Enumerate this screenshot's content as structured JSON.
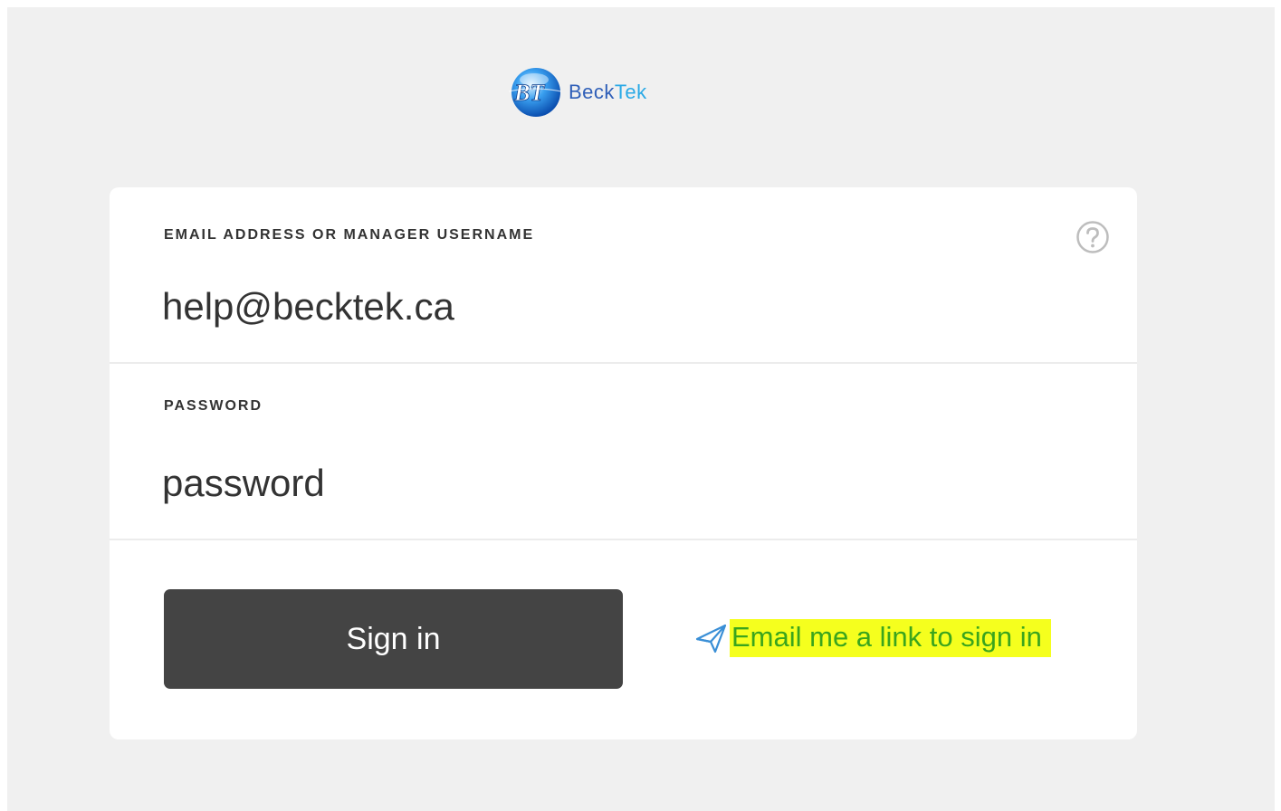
{
  "brand": {
    "logo_prefix": "Beck",
    "logo_suffix": "Tek",
    "logo_icon": "bt-globe-logo"
  },
  "form": {
    "email": {
      "label": "EMAIL ADDRESS OR MANAGER USERNAME",
      "value": "help@becktek.ca",
      "help_icon": "question-circle-icon"
    },
    "password": {
      "label": "PASSWORD",
      "value": "password"
    },
    "signin_label": "Sign in",
    "magic_link": {
      "icon": "paper-plane-icon",
      "label": "Email me a link to sign in",
      "highlight_color": "#f5ff1e",
      "text_color": "#3aa51d"
    }
  },
  "colors": {
    "page_background": "#f0f0f0",
    "card_background": "#ffffff",
    "button_background": "#444444",
    "icon_blue": "#3a8fd6"
  }
}
